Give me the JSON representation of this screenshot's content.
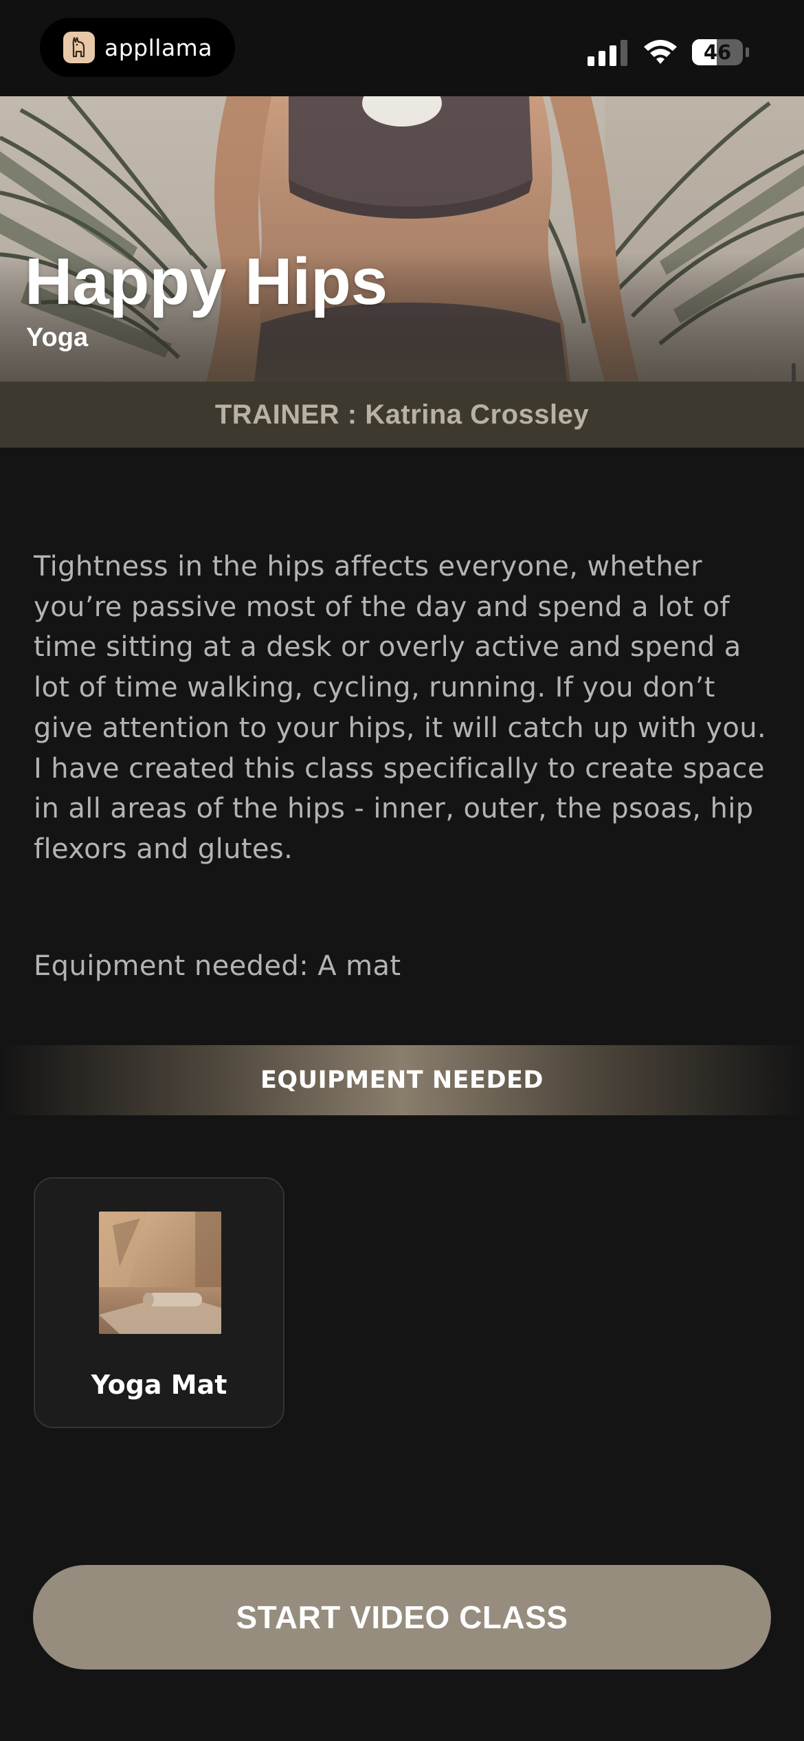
{
  "status_bar": {
    "app_name": "appllama",
    "battery_level": "46",
    "icons": [
      "llama-logo-icon",
      "cellular-signal-icon",
      "wifi-icon",
      "battery-icon"
    ]
  },
  "hero": {
    "title": "Happy Hips",
    "subtitle": "Yoga"
  },
  "trainer": {
    "text": "TRAINER : Katrina Crossley"
  },
  "description": "Tightness in the hips affects everyone, whether you’re passive most of the day and spend a lot of time sitting at a desk or overly active and spend a lot of time walking, cycling, running. If you don’t give attention to your hips, it will catch up with you. I have created this class specifically to create space in all areas of the hips -  inner, outer, the psoas, hip flexors and glutes.",
  "equipment_line": "Equipment needed: A mat",
  "equipment_section": {
    "header": "EQUIPMENT NEEDED",
    "items": [
      {
        "label": "Yoga Mat"
      }
    ]
  },
  "cta": {
    "label": "START VIDEO CLASS"
  },
  "colors": {
    "background": "#141414",
    "trainer_bar": "#3e392f",
    "cta": "#968d7e",
    "body_text": "#b4b4b4"
  }
}
